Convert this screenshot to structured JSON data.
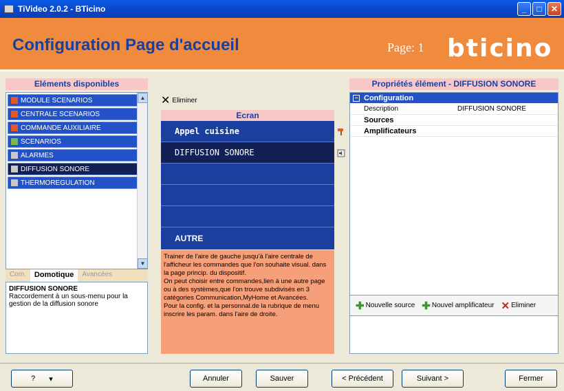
{
  "window": {
    "title": "TiVideo 2.0.2 - BTicino"
  },
  "header": {
    "title": "Configuration Page d'accueil",
    "page_label": "Page: 1",
    "logo": "bticino"
  },
  "left": {
    "title": "Eléments disponibles",
    "items": [
      {
        "label": "MODULE SCENARIOS",
        "icon": "hammer-icon"
      },
      {
        "label": "CENTRALE SCENARIOS",
        "icon": "hammer-icon"
      },
      {
        "label": "COMMANDE AUXILIAIRE",
        "icon": "hammer-icon"
      },
      {
        "label": "SCENARIOS",
        "icon": "module-icon"
      },
      {
        "label": "ALARMES",
        "icon": "alarm-icon"
      },
      {
        "label": "DIFFUSION SONORE",
        "icon": "speaker-icon"
      },
      {
        "label": "THERMOREGULATION",
        "icon": "thermo-icon"
      }
    ],
    "tabs": [
      "Com.",
      "Domotique",
      "Avancées"
    ],
    "desc_title": "DIFFUSION SONORE",
    "desc_text": "Raccordement à un sous-menu pour la gestion de la diffusion sonore"
  },
  "center": {
    "eliminer": "Eliminer",
    "screen_title": "Ecran",
    "rows": [
      "Appel cuisine",
      "DIFFUSION SONORE",
      "",
      "",
      "",
      "AUTRE"
    ],
    "info": "Trainer de l'aire de gauche jusqu'à l'aire centrale de l'afficheur les commandes que l'on souhaite visual. dans la page princip. du dispositif.\nOn peut choisir entre commandes,lien à une autre page ou à des systèmes,que l'on trouve subdivisés en 3 catégories Communication,MyHome et Avancées.\nPour la config. et la personnal.de la rubrique de menu inscrire les param. dans l'aire de droite."
  },
  "right": {
    "title": "Propriétés élément - DIFFUSION SONORE",
    "config_label": "Configuration",
    "desc_key": "Description",
    "desc_val": "DIFFUSION SONORE",
    "sources": "Sources",
    "amplificateurs": "Amplificateurs",
    "new_source": "Nouvelle source",
    "new_amp": "Nouvel amplificateur",
    "eliminer": "Eliminer"
  },
  "footer": {
    "help": "?",
    "annuler": "Annuler",
    "sauver": "Sauver",
    "precedent": "< Précédent",
    "suivant": "Suivant >",
    "fermer": "Fermer"
  }
}
